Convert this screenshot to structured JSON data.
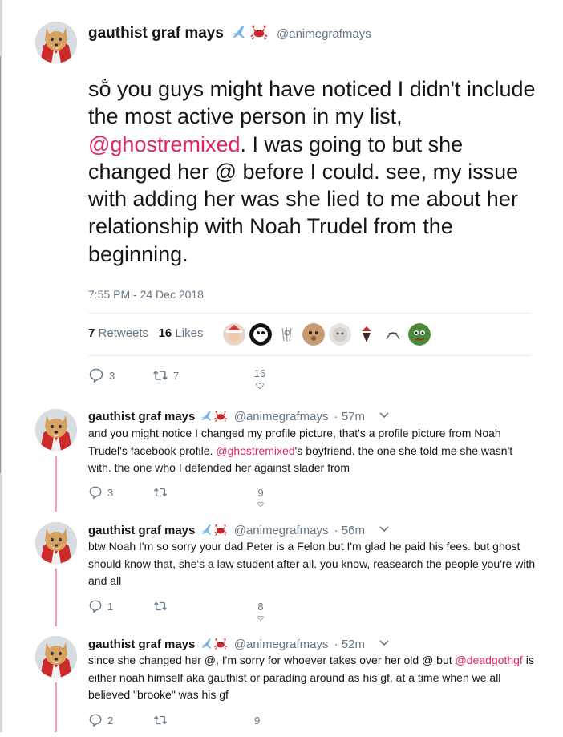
{
  "main_tweet": {
    "name": "gauthist graf mays",
    "handle": "@animegrafmays",
    "text_parts": {
      "before": "so̐ you guys might have noticed I didn't include the most active person in my list, ",
      "mention": "@ghostremixed",
      "after": ". I was going to but she changed her @ before I could. see, my issue with adding her was she lied to me about her relationship with Noah Trudel from the beginning."
    },
    "timestamp": "7:55 PM - 24 Dec 2018",
    "retweets_count": "7",
    "retweets_label": "Retweets",
    "likes_count": "16",
    "likes_label": "Likes",
    "actions": {
      "replies": "3",
      "retweets": "7",
      "likes": "16"
    }
  },
  "replies": [
    {
      "name": "gauthist graf mays",
      "handle": "@animegrafmays",
      "time": "· 57m",
      "text_before": "and you might notice I changed my profile picture, that's a profile picture from Noah Trudel's facebook profile. ",
      "mention": "@ghostremixed",
      "text_after": "'s boyfriend. the one she told me she wasn't with. the one who I defended her against slader from",
      "actions": {
        "replies": "3",
        "retweets": "",
        "likes": "9"
      }
    },
    {
      "name": "gauthist graf mays",
      "handle": "@animegrafmays",
      "time": "· 56m",
      "text_before": "btw Noah I'm so sorry your dad Peter is a Felon but I'm glad he paid his fees. but ghost should know that, she's a law student after all. you know, reasearch the people you're with and all",
      "mention": "",
      "text_after": "",
      "actions": {
        "replies": "1",
        "retweets": "",
        "likes": "8"
      }
    },
    {
      "name": "gauthist graf mays",
      "handle": "@animegrafmays",
      "time": "· 52m",
      "text_before": "since she changed her @, I'm sorry for whoever takes over her old @ but ",
      "mention": "@deadgothgf",
      "text_after": " is either noah himself aka gauthist or parading around as his gf, at a time when we all believed \"brooke\" was his gf",
      "actions": {
        "replies": "2",
        "retweets": "",
        "likes": "9"
      }
    }
  ],
  "icons": {
    "emoji_1": "airplane-emoji",
    "emoji_2": "crab-emoji",
    "reply": "reply-icon",
    "retweet": "retweet-icon",
    "like": "heart-icon",
    "more": "chevron-down-icon"
  },
  "colors": {
    "link": "#e0245e",
    "text": "#14171a",
    "muted": "#657786",
    "thread_line": "#eda4b4",
    "divider": "#e6ecf0"
  }
}
